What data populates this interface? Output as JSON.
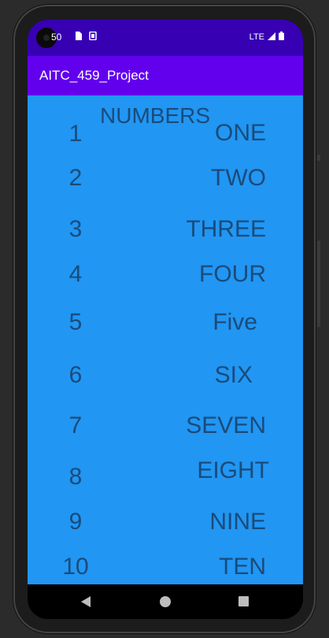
{
  "status_bar": {
    "time": "50",
    "network": "LTE",
    "icons": [
      "sim-card-icon",
      "sync-icon",
      "signal-icon",
      "battery-icon"
    ]
  },
  "app_bar": {
    "title": "AITC_459_Project",
    "color": "#6200ee"
  },
  "content": {
    "heading": "NUMBERS",
    "background": "#2196f3",
    "rows": [
      {
        "number": "1",
        "word": "ONE"
      },
      {
        "number": "2",
        "word": "TWO"
      },
      {
        "number": "3",
        "word": "THREE"
      },
      {
        "number": "4",
        "word": "FOUR"
      },
      {
        "number": "5",
        "word": "Five"
      },
      {
        "number": "6",
        "word": "SIX"
      },
      {
        "number": "7",
        "word": "SEVEN"
      },
      {
        "number": "8",
        "word": "EIGHT"
      },
      {
        "number": "9",
        "word": "NINE"
      },
      {
        "number": "10",
        "word": "TEN"
      }
    ]
  },
  "nav_bar": {
    "buttons": [
      "back-icon",
      "home-icon",
      "recents-icon"
    ]
  }
}
